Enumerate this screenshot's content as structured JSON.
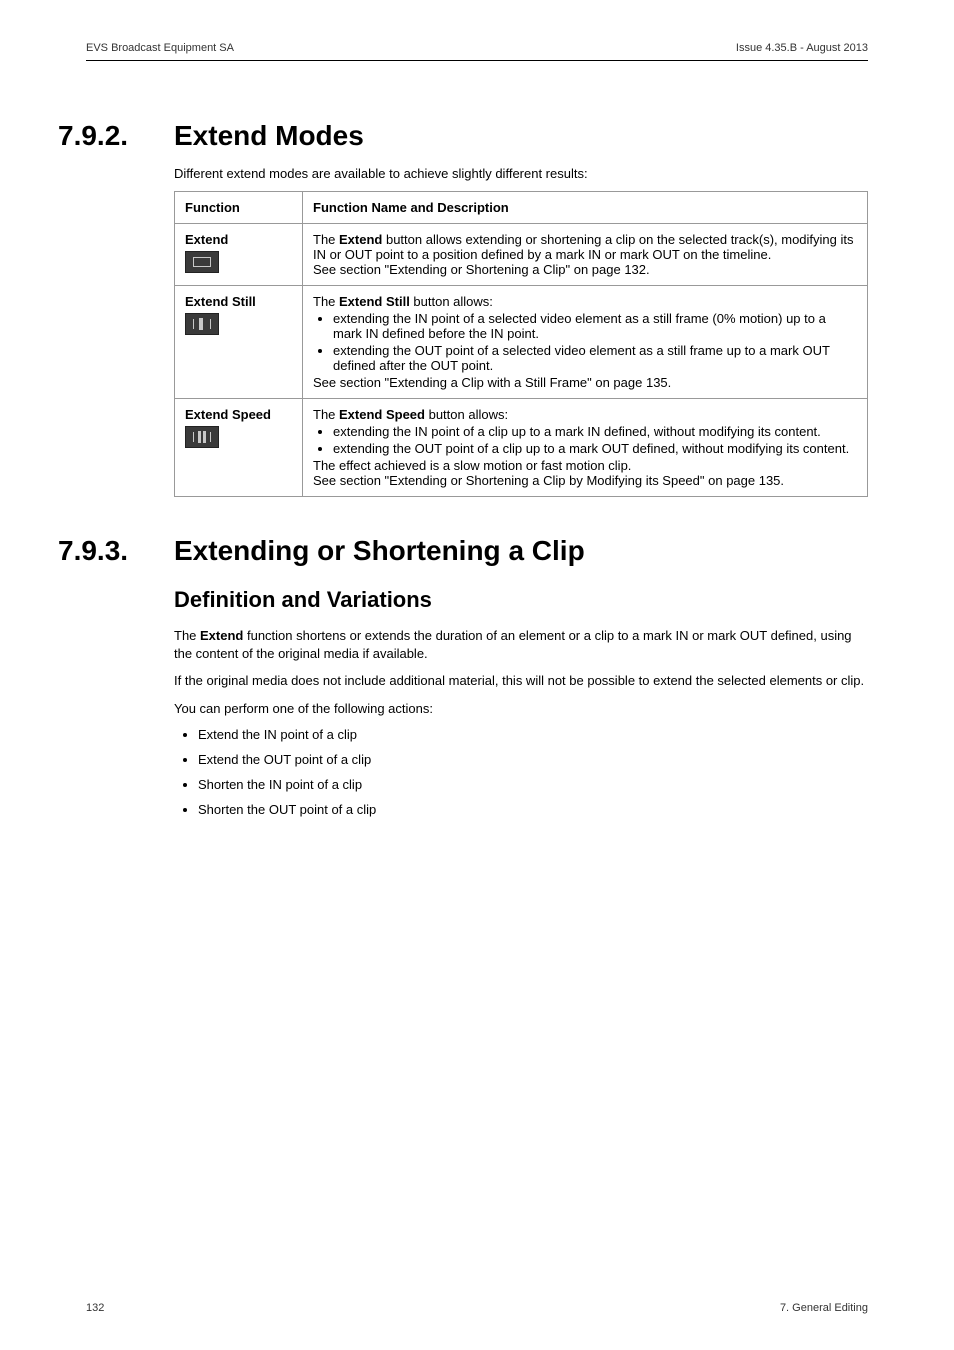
{
  "header": {
    "left": "EVS Broadcast Equipment SA",
    "right": "Issue 4.35.B - August 2013"
  },
  "sections": [
    {
      "num": "7.9.2.",
      "title": "Extend Modes",
      "intro": "Different extend modes are available to achieve slightly different results:",
      "table": {
        "head": {
          "c1": "Function",
          "c2": "Function Name and Description"
        },
        "rows": [
          {
            "label": "Extend",
            "icon": "extend",
            "pre": "The ",
            "bold": "Extend",
            "post1": " button allows extending or shortening a clip on the selected track(s), modifying its IN or OUT point to a position defined by a mark IN or mark OUT on the timeline.",
            "post2": "See section \"Extending or Shortening a Clip\" on page 132."
          },
          {
            "label": "Extend Still",
            "icon": "still",
            "pre": "The ",
            "bold": "Extend Still",
            "post1": " button allows:",
            "bullets": [
              "extending the IN point of a selected video element as a still frame (0% motion) up to a mark IN defined before the IN point.",
              "extending the OUT point of a selected video element as a still frame up to a mark OUT defined after the OUT point."
            ],
            "post2": "See section \"Extending a Clip with a Still Frame\" on page 135."
          },
          {
            "label": "Extend Speed",
            "icon": "speed",
            "pre": "The ",
            "bold": "Extend Speed",
            "post1": " button allows:",
            "bullets": [
              "extending the IN point of a clip up to a mark IN defined, without modifying its content.",
              "extending the OUT point of a clip up to a mark OUT defined, without modifying its content."
            ],
            "post3": "The effect achieved is a slow motion or fast motion clip.",
            "post2": "See section \"Extending or Shortening a Clip by Modifying its Speed\" on page 135."
          }
        ]
      }
    },
    {
      "num": "7.9.3.",
      "title": "Extending or Shortening a Clip",
      "subhead": "Definition and Variations",
      "paras": [
        {
          "pre": "The ",
          "bold": "Extend",
          "post": " function shortens or extends the duration of an element or a clip to a mark IN or mark OUT defined, using the content of the original media if available."
        },
        {
          "text": "If the original media does not include additional material, this will not be possible to extend the selected elements or clip."
        },
        {
          "text": "You can perform one of the following actions:"
        }
      ],
      "bullets": [
        "Extend the IN point of a clip",
        "Extend the OUT point of a clip",
        "Shorten the IN point of a clip",
        "Shorten the OUT point of a clip"
      ]
    }
  ],
  "footer": {
    "left": "132",
    "right": "7. General Editing"
  }
}
